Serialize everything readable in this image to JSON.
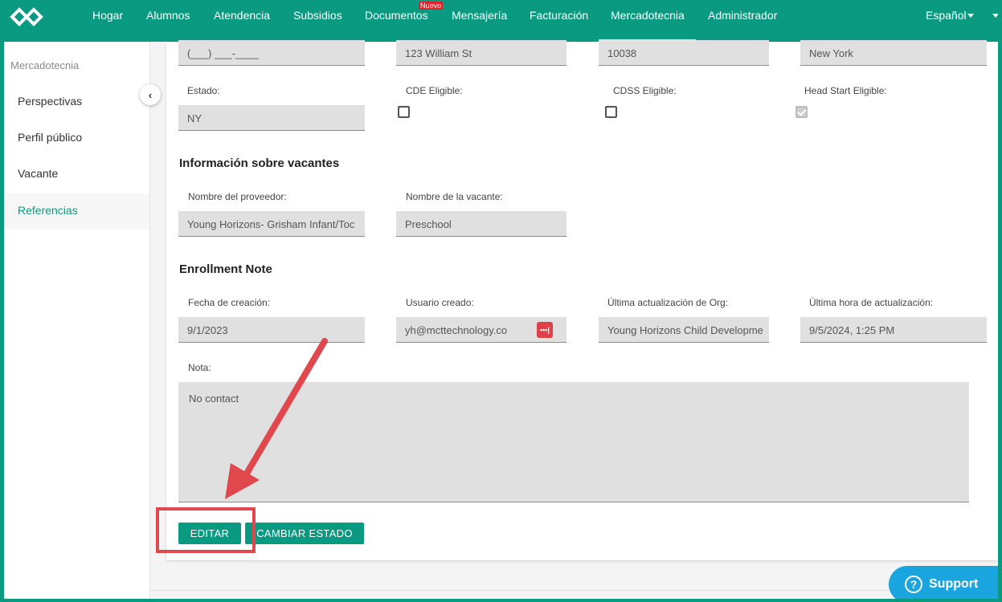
{
  "nav": {
    "items": [
      "Hogar",
      "Alumnos",
      "Atendencia",
      "Subsidios",
      "Documentos",
      "Mensajería",
      "Facturación",
      "Mercadotecnia",
      "Administrador"
    ],
    "badge": "Nuevo",
    "language": "Español"
  },
  "sidebar": {
    "header": "Mercadotecnia",
    "items": [
      "Perspectivas",
      "Perfil público",
      "Vacante",
      "Referencias"
    ],
    "active": "Referencias"
  },
  "address": {
    "phone": "(___) ___-____",
    "street": "123 William St",
    "zip": "10038",
    "city": "New York"
  },
  "eligibility": {
    "estado_label": "Estado:",
    "estado_value": "NY",
    "cde_label": "CDE Eligible:",
    "cdss_label": "CDSS Eligible:",
    "headstart_label": "Head Start Eligible:"
  },
  "vacancy": {
    "title": "Información sobre vacantes",
    "provider_label": "Nombre del proveedor:",
    "provider_value": "Young Horizons- Grisham Infant/Toc",
    "vacancy_label": "Nombre de la vacante:",
    "vacancy_value": "Preschool"
  },
  "enrollment": {
    "title": "Enrollment Note",
    "created_label": "Fecha de creación:",
    "created_value": "9/1/2023",
    "user_label": "Usuario creado:",
    "user_value": "yh@mcttechnology.co",
    "org_label": "Última actualización de Org:",
    "org_value": "Young Horizons Child Developme",
    "time_label": "Última hora de actualización:",
    "time_value": "9/5/2024, 1:25 PM",
    "note_label": "Nota:",
    "note_value": "No contact"
  },
  "actions": {
    "edit": "EDITAR",
    "change_status": "CAMBIAR ESTADO"
  },
  "support": {
    "label": "Support",
    "icon": "?"
  },
  "colors": {
    "brand": "#0a9a82",
    "annotation": "#e0484e",
    "support": "#1aa5de"
  }
}
